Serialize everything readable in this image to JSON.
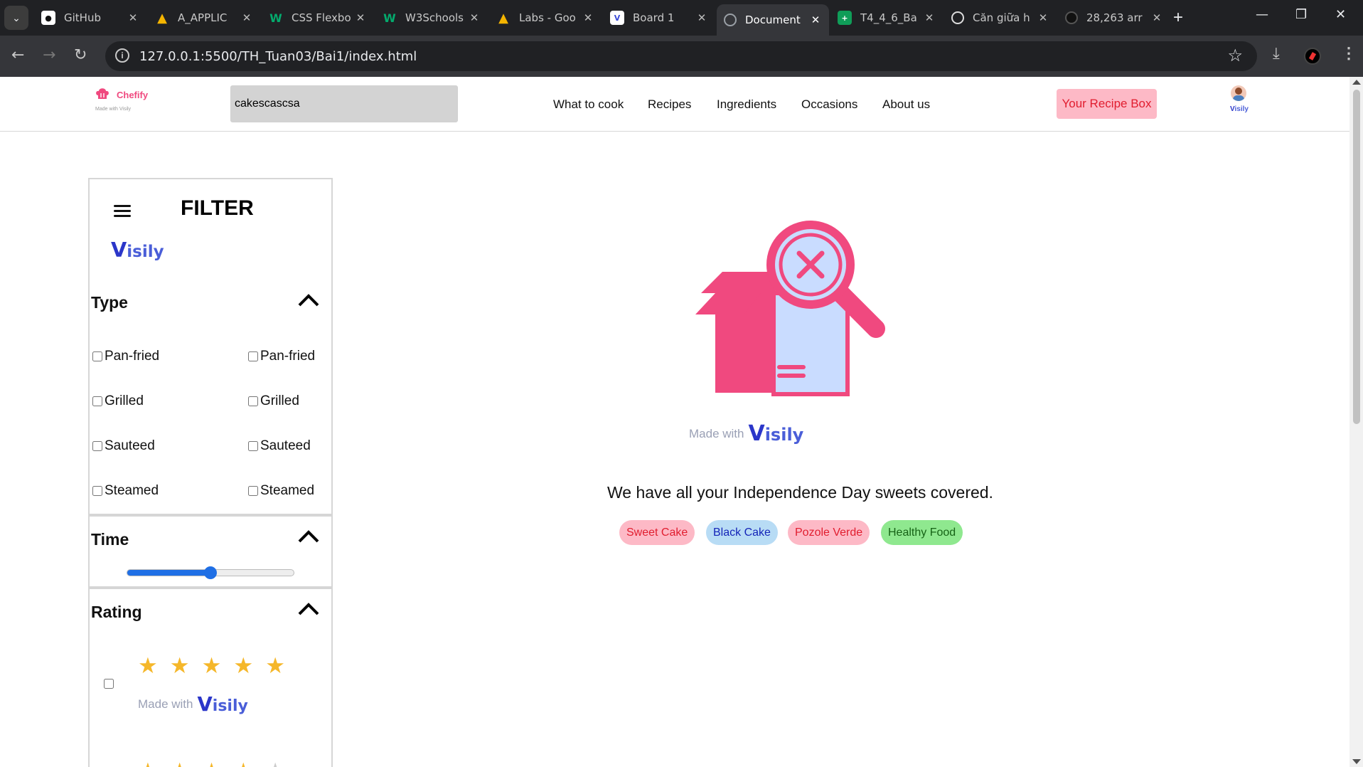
{
  "browser": {
    "tabs": [
      {
        "label": "GitHub",
        "icon": "github-icon",
        "color": "#ffffff"
      },
      {
        "label": "A_APPLIC",
        "icon": "google-drive-icon",
        "color": "#f4b400"
      },
      {
        "label": "CSS Flexbo",
        "icon": "w3schools-icon",
        "color": "#04aa6d"
      },
      {
        "label": "W3Schools",
        "icon": "w3schools-icon",
        "color": "#04aa6d"
      },
      {
        "label": "Labs - Goo",
        "icon": "google-drive-icon",
        "color": "#f4b400"
      },
      {
        "label": "Board 1",
        "icon": "visily-icon",
        "color": "#3b4bd8"
      },
      {
        "label": "Document",
        "icon": "globe-icon",
        "color": "#9aa0a6",
        "active": true
      },
      {
        "label": "T4_4_6_Ba",
        "icon": "google-sheets-icon",
        "color": "#0f9d58"
      },
      {
        "label": "Căn giữa h",
        "icon": "chatgpt-icon",
        "color": "#ffffff"
      },
      {
        "label": "28,263 arr",
        "icon": "openai-icon",
        "color": "#111111"
      }
    ],
    "url": "127.0.0.1:5500/TH_Tuan03/Bai1/index.html"
  },
  "header": {
    "brand": "Chefify",
    "brand_sub": "Made with Visily",
    "search_value": "cakescascsa",
    "nav": [
      "What to cook",
      "Recipes",
      "Ingredients",
      "Occasions",
      "About us"
    ],
    "recipe_box": "Your Recipe Box",
    "avatar_caption": "isily"
  },
  "filter": {
    "title": "FILTER",
    "logo_text": "isily",
    "type_title": "Type",
    "type_options_left": [
      "Pan-fried",
      "Grilled",
      "Sauteed",
      "Steamed"
    ],
    "type_options_right": [
      "Pan-fried",
      "Grilled",
      "Sauteed",
      "Steamed"
    ],
    "time_title": "Time",
    "time_value_fraction": 0.5,
    "rating_title": "Rating",
    "ratings": [
      5,
      4
    ],
    "made_with": "Made with",
    "made_with_brand": "isily"
  },
  "empty_state": {
    "made_with": "Made with",
    "made_with_brand": "isily",
    "message": "We have all your Independence Day sweets covered.",
    "tags": [
      {
        "label": "Sweet Cake",
        "bg": "#fdb9c6",
        "fg": "#e11d2f"
      },
      {
        "label": "Black Cake",
        "bg": "#b8dcf5",
        "fg": "#1424b8"
      },
      {
        "label": "Pozole Verde",
        "bg": "#fdb9c6",
        "fg": "#e11d2f"
      },
      {
        "label": "Healthy Food",
        "bg": "#8fe88f",
        "fg": "#166316"
      }
    ]
  },
  "colors": {
    "accent_pink": "#f0497f",
    "visily_blue": "#4a5ed8",
    "slider_blue": "#1f6fe5",
    "star_yellow": "#f5b72a"
  }
}
